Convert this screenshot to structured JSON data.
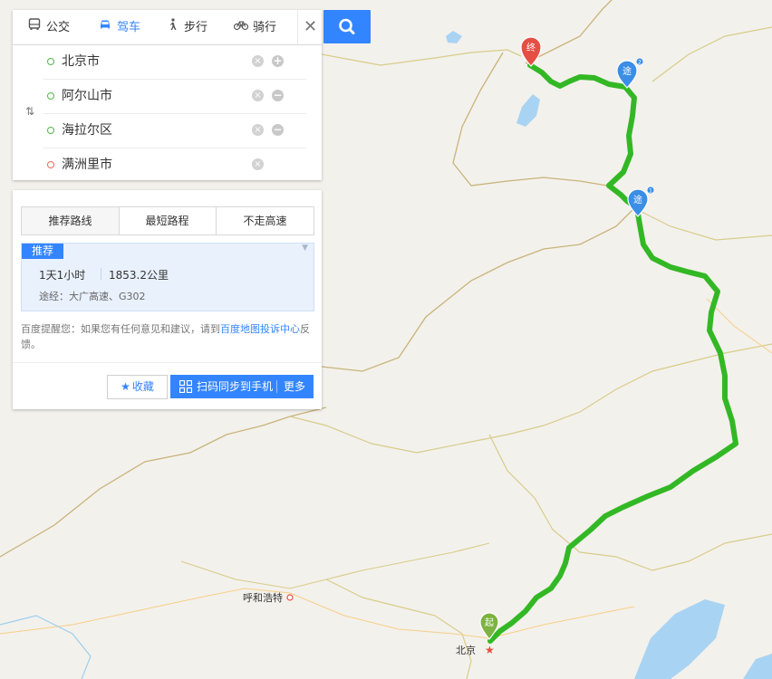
{
  "modes": [
    {
      "label": "公交",
      "icon": "bus-icon",
      "active": false
    },
    {
      "label": "驾车",
      "icon": "car-icon",
      "active": true
    },
    {
      "label": "步行",
      "icon": "walk-icon",
      "active": false
    },
    {
      "label": "骑行",
      "icon": "bike-icon",
      "active": false
    }
  ],
  "close_glyph": "✕",
  "waypoints": [
    {
      "name": "北京市",
      "action": "add"
    },
    {
      "name": "阿尔山市",
      "action": "remove"
    },
    {
      "name": "海拉尔区",
      "action": "remove"
    },
    {
      "name": "满洲里市",
      "action": "none"
    }
  ],
  "swap_glyph": "⇅",
  "route_tabs": [
    "推荐路线",
    "最短路程",
    "不走高速"
  ],
  "route": {
    "badge": "推荐",
    "duration": "1天1小时",
    "distance": "1853.2公里",
    "via": "途经：大广高速、G302"
  },
  "notice": {
    "before": "百度提醒您：如果您有任何意见和建议，请到",
    "link": "百度地图投诉中心",
    "after": "反馈。"
  },
  "actions": {
    "favorite": "收藏",
    "sync": "扫码同步到手机",
    "more": "更多"
  },
  "map": {
    "markers": {
      "start": "起",
      "end": "终",
      "via": "途",
      "via1_index": "1",
      "via2_index": "2"
    },
    "cities": {
      "hohhot": "呼和浩特",
      "beijing": "北京"
    },
    "colors": {
      "route": "#33b825",
      "start_marker": "#7cb342",
      "end_marker": "#e54f43",
      "via_marker": "#3a8ee6",
      "accent": "#3385ff",
      "water": "#a9d3f2"
    }
  }
}
